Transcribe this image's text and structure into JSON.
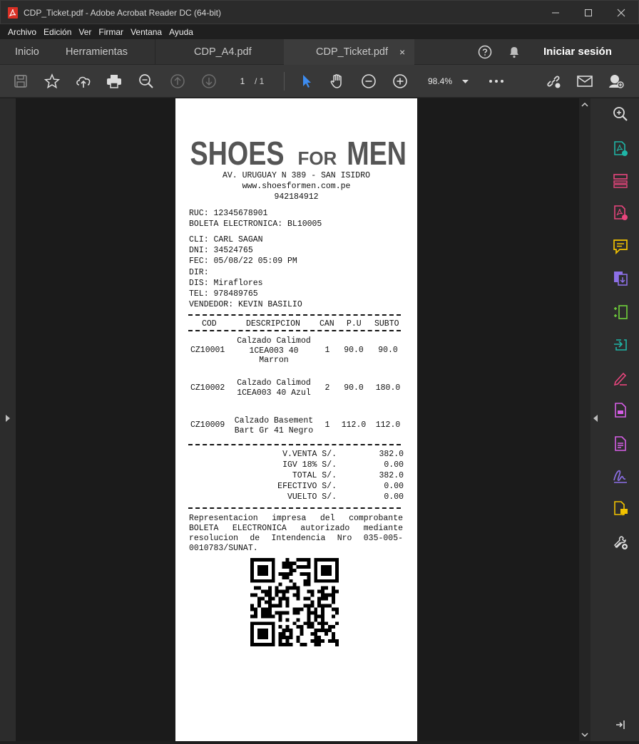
{
  "window": {
    "title": "CDP_Ticket.pdf - Adobe Acrobat Reader DC (64-bit)",
    "controls": [
      "minimize",
      "maximize",
      "close"
    ]
  },
  "menu": [
    "Archivo",
    "Edición",
    "Ver",
    "Firmar",
    "Ventana",
    "Ayuda"
  ],
  "tabs": {
    "home": "Inicio",
    "tools": "Herramientas",
    "doc1": "CDP_A4.pdf",
    "doc2": "CDP_Ticket.pdf",
    "close_glyph": "×",
    "signin": "Iniciar sesión"
  },
  "toolbar": {
    "page_current": "1",
    "page_total": "/  1",
    "zoom": "98.4%",
    "icons": [
      "save-icon",
      "star-icon",
      "cloud-upload-icon",
      "print-icon",
      "zoom-search-icon",
      "page-up-icon",
      "page-down-icon",
      "select-cursor-icon",
      "hand-icon",
      "zoom-out-icon",
      "zoom-in-icon",
      "more-icon",
      "share-link-icon",
      "email-icon",
      "add-user-icon"
    ]
  },
  "right_panel_tools": [
    "search-zoom-icon",
    "export-pdf-icon",
    "organize-pages-icon",
    "create-pdf-icon",
    "comment-icon",
    "combine-files-icon",
    "compress-icon",
    "export-icon",
    "fill-sign-icon",
    "edit-pdf-icon",
    "protect-icon",
    "sign-icon",
    "send-for-comments-icon",
    "more-tools-icon"
  ],
  "colors": {
    "accent_blue": "#3d8cf0",
    "teal": "#1fb5a6",
    "pink": "#e8457d",
    "yellow": "#f2c200",
    "purple": "#8c6fe6",
    "magenta": "#d65ee6"
  },
  "receipt": {
    "logo_a": "SHOES",
    "logo_b": "FOR",
    "logo_c": "MEN",
    "address": "AV. URUGUAY N 389 - SAN ISIDRO",
    "website": "www.shoesformen.com.pe",
    "phone": "942184912",
    "ruc": "RUC: 12345678901",
    "boleta": "BOLETA ELECTRONICA: BL10005",
    "cli": "CLI: CARL SAGAN",
    "dni": "DNI: 34524765",
    "fec": "FEC: 05/08/22 05:09 PM",
    "dir": "DIR:",
    "dis": "DIS: Miraflores",
    "tel": "TEL: 978489765",
    "vendedor": "VENDEDOR: KEVIN BASILIO",
    "headers": [
      "COD",
      "DESCRIPCION",
      "CAN",
      "P.U",
      "SUBTO"
    ],
    "items": [
      {
        "cod": "CZ10001",
        "desc1": "Calzado Calimod",
        "desc2": "1CEA003 40",
        "desc3": "Marron",
        "can": "1",
        "pu": "90.0",
        "subto": "90.0"
      },
      {
        "cod": "CZ10002",
        "desc1": "Calzado Calimod",
        "desc2": "1CEA003 40 Azul",
        "desc3": "",
        "can": "2",
        "pu": "90.0",
        "subto": "180.0"
      },
      {
        "cod": "CZ10009",
        "desc1": "Calzado Basement",
        "desc2": "Bart Gr 41 Negro",
        "desc3": "",
        "can": "1",
        "pu": "112.0",
        "subto": "112.0"
      }
    ],
    "totals": [
      {
        "label": "V.VENTA S/.",
        "value": "382.0"
      },
      {
        "label": "IGV 18% S/.",
        "value": "0.00"
      },
      {
        "label": "TOTAL S/.",
        "value": "382.0"
      },
      {
        "label": "EFECTIVO S/.",
        "value": "0.00"
      },
      {
        "label": "VUELTO S/.",
        "value": "0.00"
      }
    ],
    "legal": "Representacion impresa del comprobante BOLETA ELECTRONICA autorizado mediante resolucion de Intendencia Nro 035-005-0010783/SUNAT."
  }
}
